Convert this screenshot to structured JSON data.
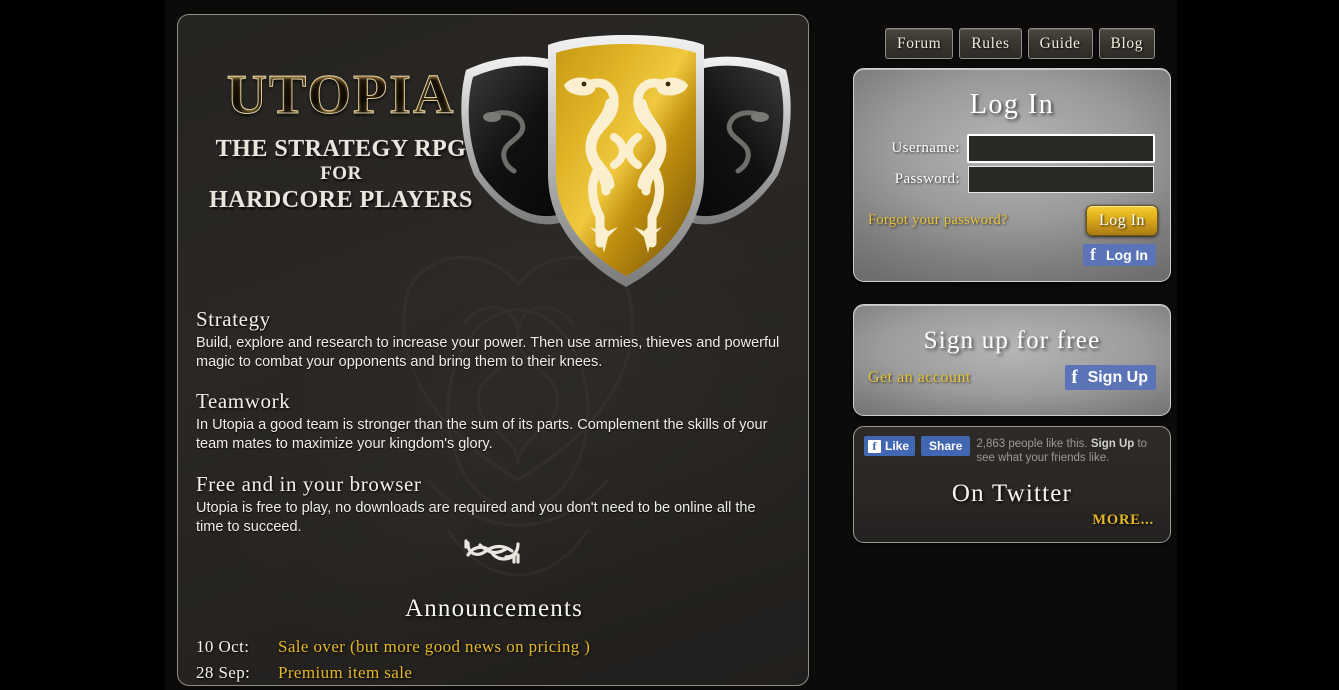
{
  "brand": {
    "wordmark": "UTOPIA",
    "tagline_line1": "THE STRATEGY RPG",
    "tagline_line2": "FOR",
    "tagline_line3": "HARDCORE PLAYERS",
    "logo_icon": "twin-serpent-shield-crest"
  },
  "features": [
    {
      "heading": "Strategy",
      "body": "Build, explore and research to increase your power. Then use armies, thieves and powerful magic to combat your opponents and bring them to their knees."
    },
    {
      "heading": "Teamwork",
      "body": "In Utopia a good team is stronger than the sum of its parts. Complement the skills of your team mates to maximize your kingdom's glory."
    },
    {
      "heading": "Free and in your browser",
      "body": "Utopia is free to play, no downloads are required and you don't need to be online all the time to succeed."
    }
  ],
  "divider_icon": "celtic-serpent-knot",
  "announcements": {
    "title": "Announcements",
    "items": [
      {
        "date": "10 Oct:",
        "text": "Sale over  (but more good news on pricing )"
      },
      {
        "date": "28 Sep:",
        "text": "Premium item sale"
      }
    ]
  },
  "nav": {
    "items": [
      {
        "label": "Forum"
      },
      {
        "label": "Rules"
      },
      {
        "label": "Guide"
      },
      {
        "label": "Blog"
      }
    ]
  },
  "login": {
    "title": "Log In",
    "username_label": "Username:",
    "username_value": "",
    "password_label": "Password:",
    "password_value": "",
    "forgot_label": "Forgot your password?",
    "submit_label": "Log In",
    "facebook_label": "Log In",
    "facebook_icon": "facebook-f-icon"
  },
  "signup": {
    "title": "Sign up for free",
    "get_account_label": "Get an account",
    "facebook_label": "Sign Up",
    "facebook_icon": "facebook-f-icon"
  },
  "social": {
    "like_label": "Like",
    "like_icon": "facebook-f-icon",
    "share_label": "Share",
    "count_prefix": "2,863 people like this. ",
    "count_link": "Sign Up",
    "count_suffix": " to see what your friends like.",
    "twitter_title": "On Twitter",
    "more_label": "MORE..."
  },
  "colors": {
    "gold": "#e5b726",
    "gold_link": "#e8c437",
    "facebook_blue": "#4267b2",
    "panel_dark": "#2a2724",
    "panel_light": "#9a9a9a",
    "border_light": "#8e8d8a"
  }
}
